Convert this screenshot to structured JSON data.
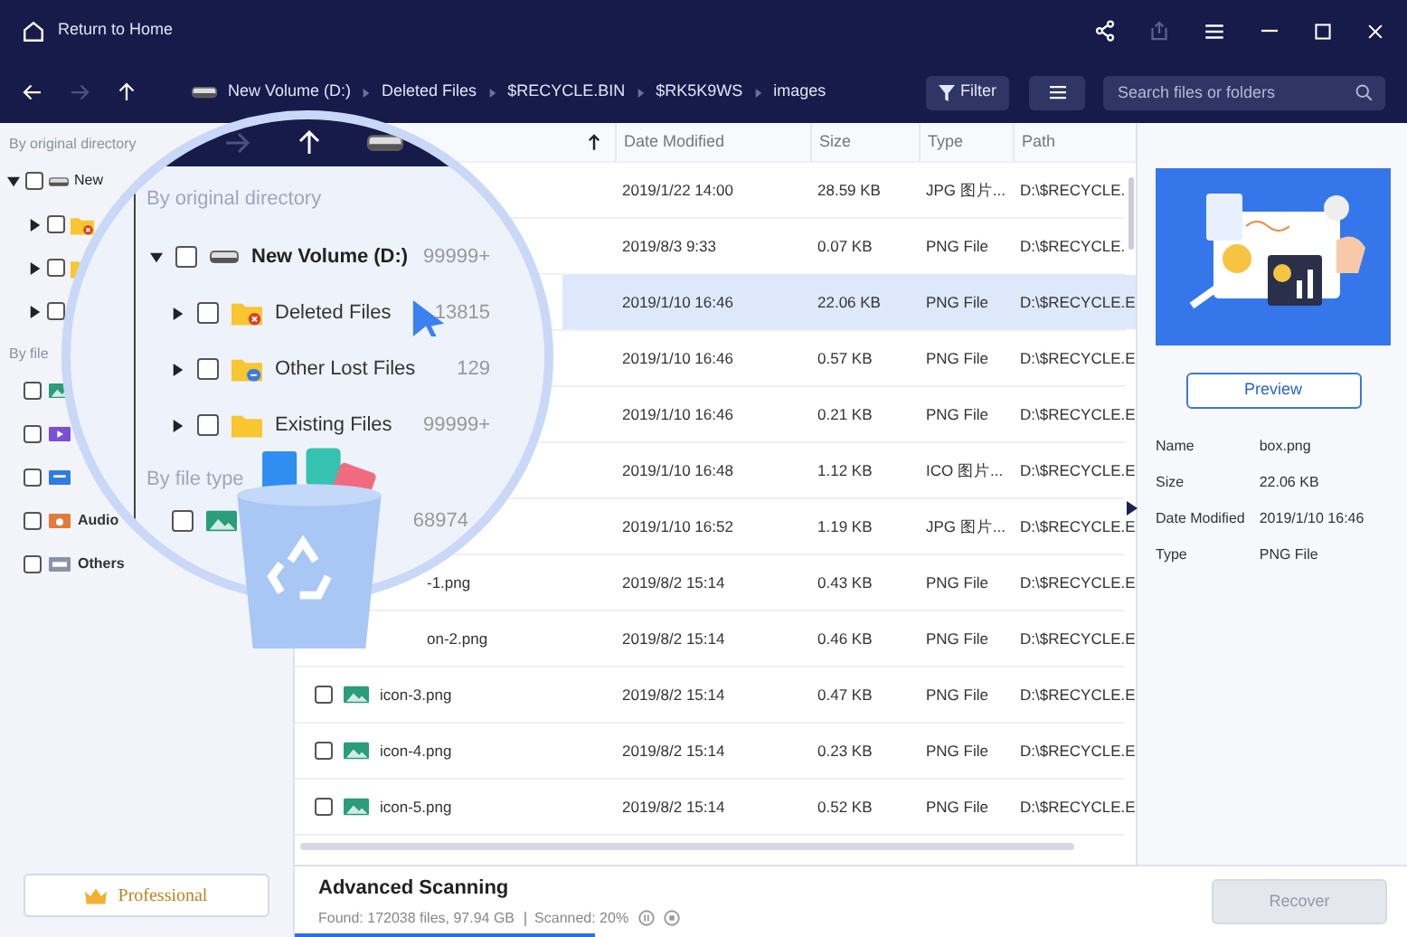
{
  "window": {
    "home_label": "Return to Home"
  },
  "toolbar": {
    "breadcrumb": [
      "New Volume (D:)",
      "Deleted Files",
      "$RECYCLE.BIN",
      "$RK5K9WS",
      "images"
    ],
    "filter_label": "Filter",
    "search": {
      "placeholder": "Search files or folders"
    }
  },
  "sidebar": {
    "directory_label": "By original directory",
    "tree": [
      {
        "name": "New",
        "checked": false,
        "expanded": true,
        "children": [
          {
            "kind": "deleted",
            "checked": false,
            "expanded": false
          },
          {
            "kind": "lost",
            "checked": false,
            "expanded": false
          },
          {
            "kind": "none",
            "checked": false,
            "expanded": false
          }
        ]
      }
    ],
    "file_label": "By file",
    "file_types": [
      {
        "kind": "image",
        "checked": false
      },
      {
        "kind": "video",
        "checked": false
      },
      {
        "kind": "document",
        "checked": false
      },
      {
        "kind": "audio",
        "name": "Audio",
        "checked": false
      },
      {
        "kind": "other",
        "name": "Others",
        "checked": false
      }
    ],
    "professional_label": "Professional"
  },
  "magnifier": {
    "directory_label": "By original directory",
    "tree": [
      {
        "name": "New Volume (D:)",
        "count": "99999+",
        "checked": false,
        "expanded": true,
        "children": [
          {
            "kind": "deleted",
            "name": "Deleted Files",
            "count": "13815",
            "checked": false,
            "expanded": false
          },
          {
            "kind": "lost",
            "name": "Other Lost Files",
            "count": "129",
            "checked": false,
            "expanded": false
          },
          {
            "kind": "existing",
            "name": "Existing Files",
            "count": "99999+",
            "checked": false,
            "expanded": false
          }
        ]
      }
    ],
    "file_type_label": "By file type",
    "file_types": [
      {
        "kind": "image",
        "count": "68974",
        "checked": false
      }
    ]
  },
  "table": {
    "columns": [
      "Date Modified",
      "Size",
      "Type",
      "Path"
    ],
    "rows": [
      {
        "date": "2019/1/22 14:00",
        "size": "28.59 KB",
        "type": "JPG 图片...",
        "path": "D:\\$RECYCLE.",
        "selected": false
      },
      {
        "date": "2019/8/3 9:33",
        "size": "0.07 KB",
        "type": "PNG File",
        "path": "D:\\$RECYCLE.",
        "selected": false
      },
      {
        "date": "2019/1/10 16:46",
        "size": "22.06 KB",
        "type": "PNG File",
        "path": "D:\\$RECYCLE.E",
        "selected": true
      },
      {
        "date": "2019/1/10 16:46",
        "size": "0.57 KB",
        "type": "PNG File",
        "path": "D:\\$RECYCLE.E",
        "selected": false
      },
      {
        "date": "2019/1/10 16:46",
        "size": "0.21 KB",
        "type": "PNG File",
        "path": "D:\\$RECYCLE.E",
        "selected": false
      },
      {
        "date": "2019/1/10 16:48",
        "size": "1.12 KB",
        "type": "ICO 图片...",
        "path": "D:\\$RECYCLE.E",
        "selected": false
      },
      {
        "date": "2019/1/10 16:52",
        "size": "1.19 KB",
        "type": "JPG 图片...",
        "path": "D:\\$RECYCLE.E",
        "selected": false
      },
      {
        "name": "-1.png",
        "date": "2019/8/2 15:14",
        "size": "0.43 KB",
        "type": "PNG File",
        "path": "D:\\$RECYCLE.E",
        "selected": false
      },
      {
        "name": "on-2.png",
        "date": "2019/8/2 15:14",
        "size": "0.46 KB",
        "type": "PNG File",
        "path": "D:\\$RECYCLE.E",
        "selected": false
      },
      {
        "name": "icon-3.png",
        "checked": false,
        "date": "2019/8/2 15:14",
        "size": "0.47 KB",
        "type": "PNG File",
        "path": "D:\\$RECYCLE.E",
        "selected": false
      },
      {
        "name": "icon-4.png",
        "checked": false,
        "date": "2019/8/2 15:14",
        "size": "0.23 KB",
        "type": "PNG File",
        "path": "D:\\$RECYCLE.E",
        "selected": false
      },
      {
        "name": "icon-5.png",
        "checked": false,
        "date": "2019/8/2 15:14",
        "size": "0.52 KB",
        "type": "PNG File",
        "path": "D:\\$RECYCLE.E",
        "selected": false
      }
    ]
  },
  "details": {
    "preview_label": "Preview",
    "fields": [
      {
        "label": "Name",
        "value": "box.png"
      },
      {
        "label": "Size",
        "value": "22.06 KB"
      },
      {
        "label": "Date Modified",
        "value": "2019/1/10 16:46"
      },
      {
        "label": "Type",
        "value": "PNG File"
      }
    ]
  },
  "status_bar": {
    "title": "Advanced Scanning",
    "found": "Found: 172038 files, 97.94 GB",
    "scanned": "Scanned: 20%",
    "level": 0.27,
    "recover_label": "Recover",
    "recover_disabled": true
  }
}
